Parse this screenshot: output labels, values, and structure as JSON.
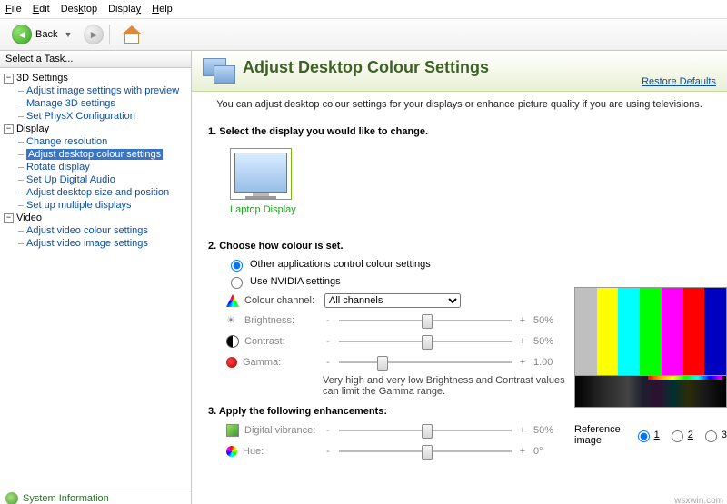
{
  "menu": {
    "file": "File",
    "edit": "Edit",
    "desktop": "Desktop",
    "display": "Display",
    "help": "Help"
  },
  "toolbar": {
    "back": "Back"
  },
  "leftHeader": "Select a Task...",
  "tree": {
    "g3d": {
      "label": "3D Settings",
      "items": [
        "Adjust image settings with preview",
        "Manage 3D settings",
        "Set PhysX Configuration"
      ]
    },
    "gdisp": {
      "label": "Display",
      "items": [
        "Change resolution",
        "Adjust desktop colour settings",
        "Rotate display",
        "Set Up Digital Audio",
        "Adjust desktop size and position",
        "Set up multiple displays"
      ]
    },
    "gvid": {
      "label": "Video",
      "items": [
        "Adjust video colour settings",
        "Adjust video image settings"
      ]
    }
  },
  "sysinfo": "System Information",
  "header": {
    "title": "Adjust Desktop Colour Settings",
    "restore": "Restore Defaults"
  },
  "sub": "You can adjust desktop colour settings for your displays or enhance picture quality if you are using televisions.",
  "step1": "1. Select the display you would like to change.",
  "displayName": "Laptop Display",
  "step2": "2. Choose how colour is set.",
  "radios": {
    "other": "Other applications control colour settings",
    "nvidia": "Use NVIDIA settings"
  },
  "channel": {
    "label": "Colour channel:",
    "value": "All channels"
  },
  "sliders": {
    "brightness": {
      "label": "Brightness:",
      "val": "50%",
      "pos": 48
    },
    "contrast": {
      "label": "Contrast:",
      "val": "50%",
      "pos": 48
    },
    "gamma": {
      "label": "Gamma:",
      "val": "1.00",
      "pos": 22
    },
    "dv": {
      "label": "Digital vibrance:",
      "val": "50%",
      "pos": 48
    },
    "hue": {
      "label": "Hue:",
      "val": "0°",
      "pos": 48
    }
  },
  "gammaNote": "Very high and very low Brightness and Contrast values can limit the Gamma range.",
  "step3": "3. Apply the following enhancements:",
  "ref": {
    "label": "Reference image:",
    "o1": "1",
    "o2": "2",
    "o3": "3"
  },
  "watermark": "wsxwin.com"
}
